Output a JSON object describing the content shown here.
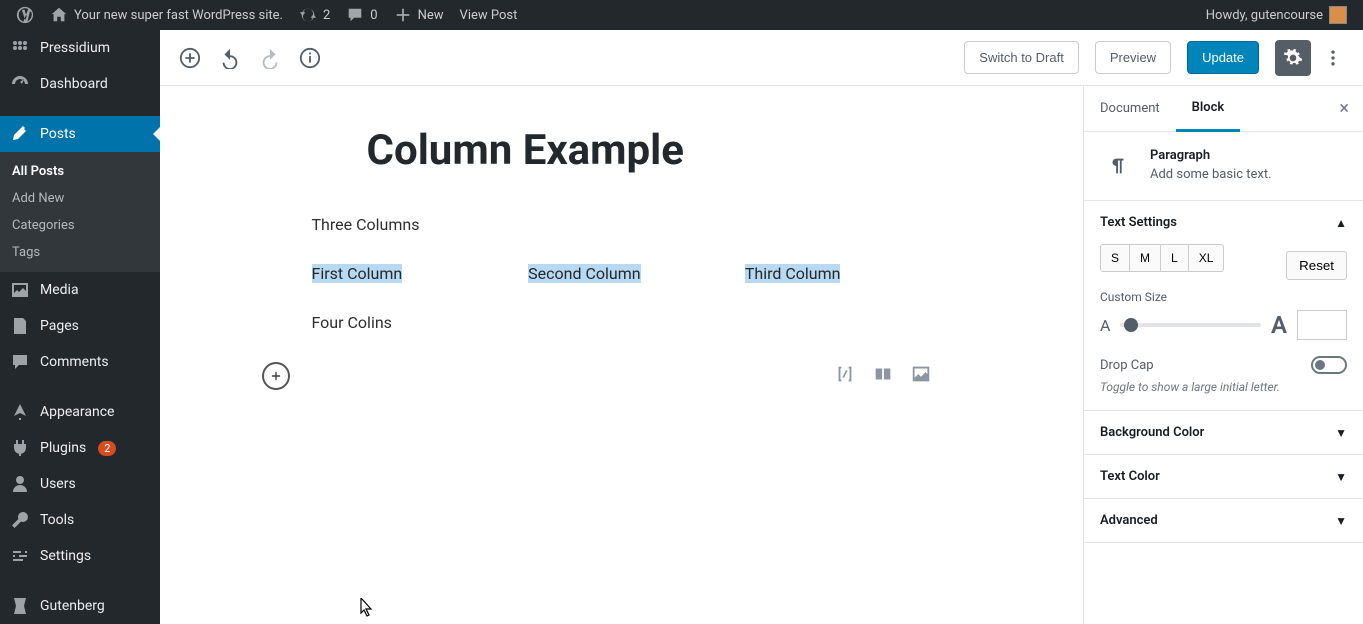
{
  "adminbar": {
    "site_title": "Your new super fast WordPress site.",
    "updates": "2",
    "comments": "0",
    "new": "New",
    "view": "View Post",
    "howdy": "Howdy, gutencourse"
  },
  "sidebar": {
    "pressidium": "Pressidium",
    "dashboard": "Dashboard",
    "posts": "Posts",
    "submenu": {
      "all_posts": "All Posts",
      "add_new": "Add New",
      "categories": "Categories",
      "tags": "Tags"
    },
    "media": "Media",
    "pages": "Pages",
    "comments": "Comments",
    "appearance": "Appearance",
    "plugins": "Plugins",
    "plugins_badge": "2",
    "users": "Users",
    "tools": "Tools",
    "settings": "Settings",
    "gutenberg": "Gutenberg"
  },
  "toolbar": {
    "switch_draft": "Switch to Draft",
    "preview": "Preview",
    "update": "Update"
  },
  "editor": {
    "title": "Column Example",
    "para1": "Three Columns",
    "col1": "First Column",
    "col2": "Second Column",
    "col3": "Third Column",
    "para2": "Four Colins"
  },
  "settings": {
    "tab_document": "Document",
    "tab_block": "Block",
    "block_name": "Paragraph",
    "block_desc": "Add some basic text.",
    "text_settings": "Text Settings",
    "sizes": {
      "s": "S",
      "m": "M",
      "l": "L",
      "xl": "XL"
    },
    "reset": "Reset",
    "custom_size": "Custom Size",
    "drop_cap": "Drop Cap",
    "drop_cap_help": "Toggle to show a large initial letter.",
    "bg_color": "Background Color",
    "text_color": "Text Color",
    "advanced": "Advanced"
  }
}
